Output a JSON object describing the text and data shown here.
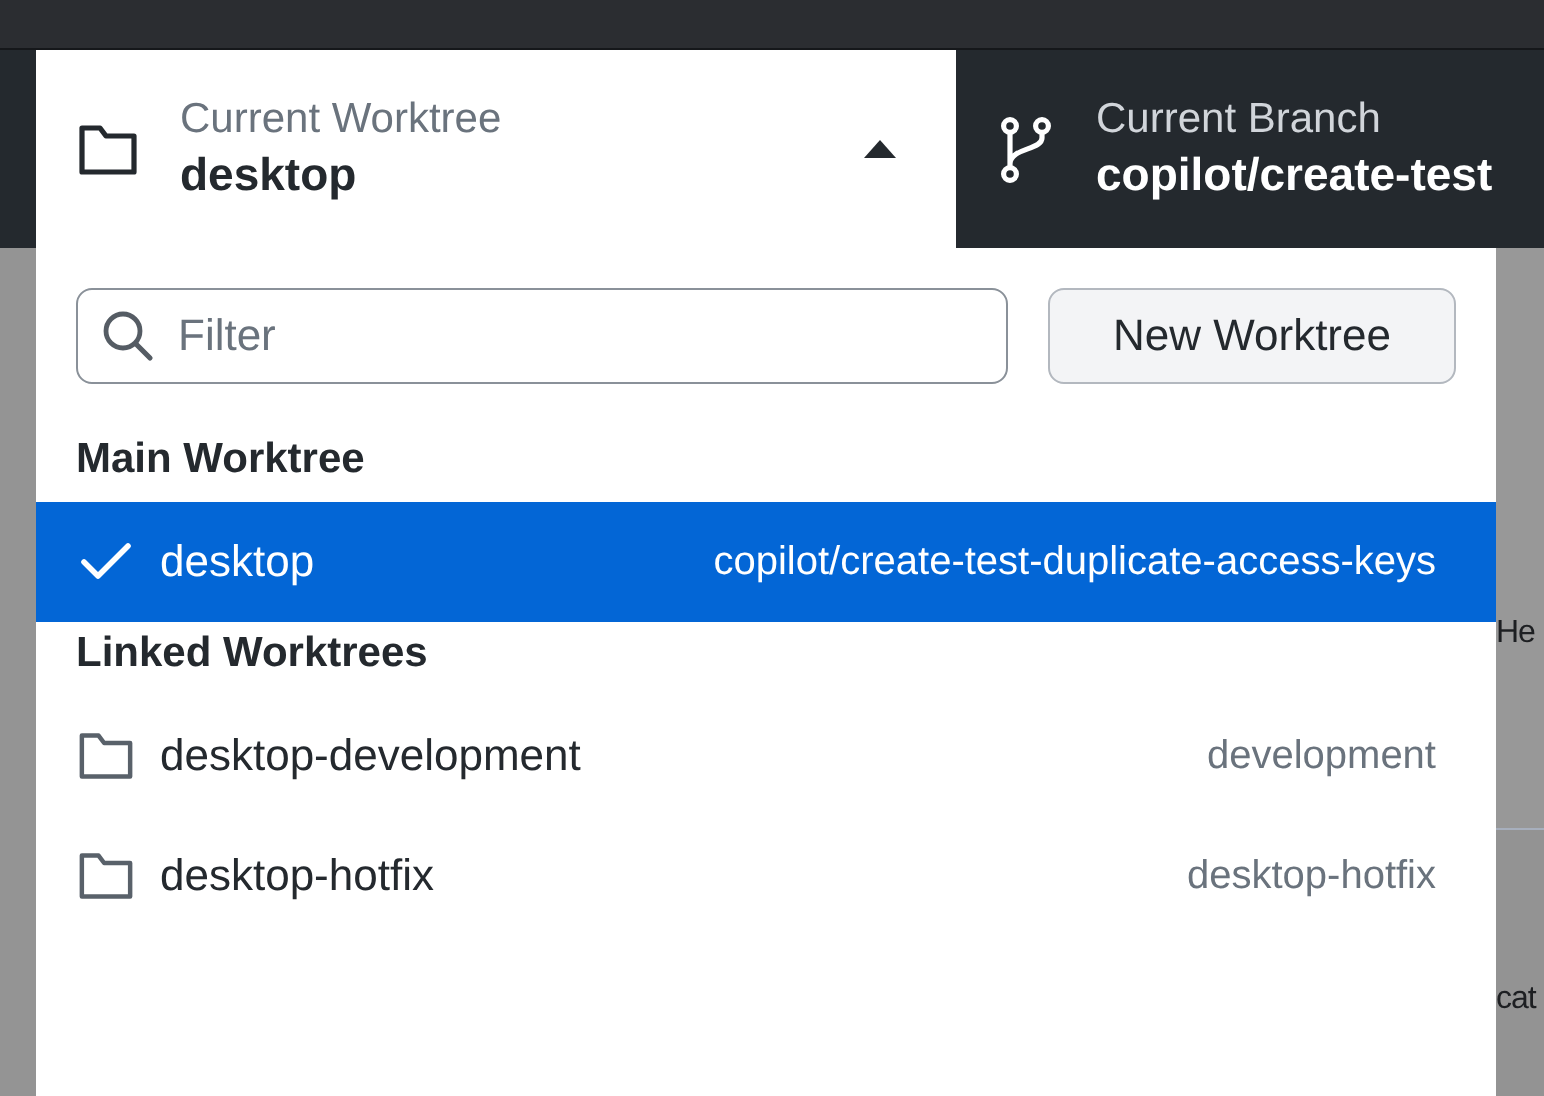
{
  "toolbar": {
    "worktree": {
      "label": "Current Worktree",
      "value": "desktop",
      "expanded": true
    },
    "branch": {
      "label": "Current Branch",
      "value": "copilot/create-test"
    }
  },
  "dropdown": {
    "filter": {
      "placeholder": "Filter"
    },
    "new_button": "New Worktree",
    "groups": [
      {
        "title": "Main Worktree",
        "items": [
          {
            "name": "desktop",
            "branch": "copilot/create-test-duplicate-access-keys",
            "selected": true
          }
        ]
      },
      {
        "title": "Linked Worktrees",
        "items": [
          {
            "name": "desktop-development",
            "branch": "development",
            "selected": false
          },
          {
            "name": "desktop-hotfix",
            "branch": "desktop-hotfix",
            "selected": false
          }
        ]
      }
    ]
  },
  "background_text": [
    "He",
    "cat"
  ]
}
